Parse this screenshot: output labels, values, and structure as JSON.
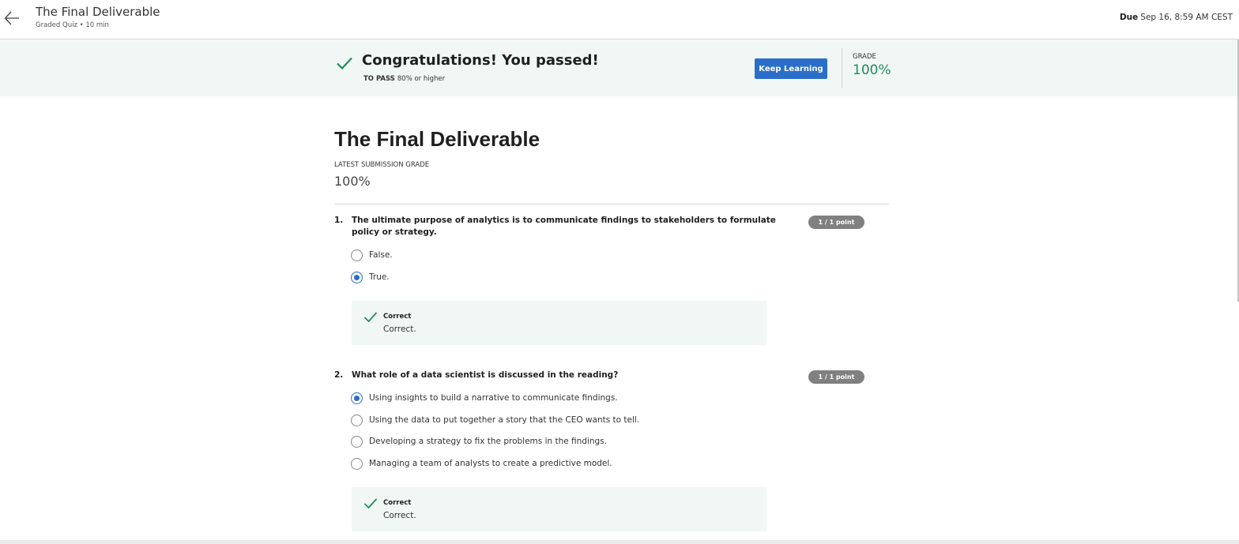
{
  "header": {
    "title": "The Final Deliverable",
    "subtitle": "Graded Quiz • 10 min",
    "due_label": "Due",
    "due_value": "Sep 16, 8:59 AM CEST"
  },
  "banner": {
    "title": "Congratulations! You passed!",
    "to_pass_label": "TO PASS",
    "to_pass_value": "80% or higher",
    "keep_learning_label": "Keep Learning",
    "grade_label": "GRADE",
    "grade_value": "100%"
  },
  "main": {
    "title": "The Final Deliverable",
    "latest_label": "LATEST SUBMISSION GRADE",
    "latest_value": "100%"
  },
  "questions": [
    {
      "number": "1.",
      "text": "The ultimate purpose of analytics is to communicate findings to stakeholders to formulate policy or strategy.",
      "points": "1 / 1 point",
      "options": [
        "False.",
        "True."
      ],
      "selected_index": 1,
      "feedback_title": "Correct",
      "feedback_text": "Correct."
    },
    {
      "number": "2.",
      "text": "What role of a data scientist is discussed in the reading?",
      "points": "1 / 1 point",
      "options": [
        "Using insights to build a narrative to communicate findings.",
        "Using the data to put together a story that the CEO wants to tell.",
        "Developing a strategy to fix the problems in the findings.",
        "Managing a team of analysts to create a predictive model."
      ],
      "selected_index": 0,
      "feedback_title": "Correct",
      "feedback_text": "Correct."
    }
  ],
  "colors": {
    "accent": "#2a6ec9",
    "success": "#1e8c5b",
    "banner_bg": "#f1f7f5",
    "pill_bg": "#808080"
  }
}
